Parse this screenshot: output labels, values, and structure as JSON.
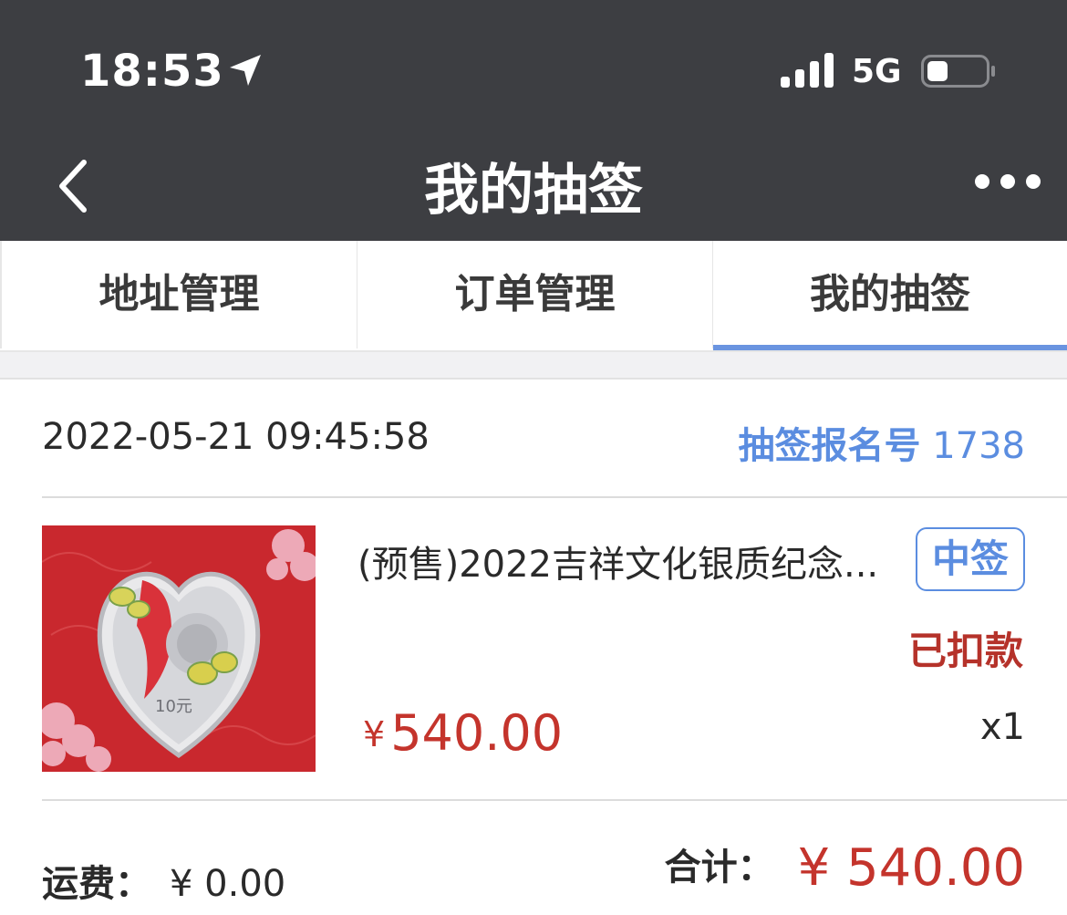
{
  "status_bar": {
    "time": "18:53",
    "network": "5G"
  },
  "nav": {
    "title": "我的抽签"
  },
  "tabs": [
    {
      "label": "地址管理"
    },
    {
      "label": "订单管理"
    },
    {
      "label": "我的抽签"
    }
  ],
  "active_tab": 2,
  "order": {
    "datetime": "2022-05-21 09:45:58",
    "lottery_label": "抽签报名号",
    "lottery_number": "1738",
    "product_name": "(预售)2022吉祥文化银质纪念...",
    "badge": "中签",
    "payment_status": "已扣款",
    "currency": "¥",
    "price": "540.00",
    "quantity": "x1",
    "coin_label": "10元",
    "shipping_label": "运费：",
    "shipping_value": "¥ 0.00",
    "total_label": "合计：",
    "total_value": "¥ 540.00"
  },
  "colors": {
    "header_bg": "#3d3e42",
    "accent_blue": "#5b8de0",
    "price_red": "#c4342c"
  }
}
